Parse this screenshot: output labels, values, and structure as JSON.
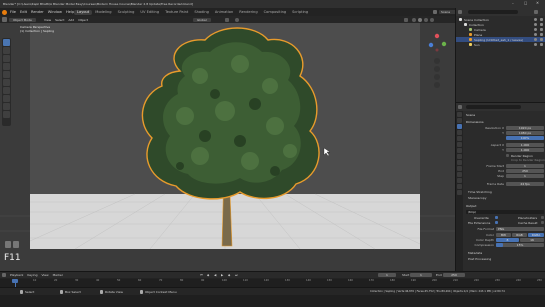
{
  "title_bar": {
    "title": "Blender* [C:\\Users\\Kapil Bhatti\\A Blender Model Easy\\Courses\\Modern House Course\\Blender 2.8 Update\\Free Recorded.blend]"
  },
  "top_menu": [
    "File",
    "Edit",
    "Render",
    "Window",
    "Help"
  ],
  "workspace_tabs": [
    {
      "label": "Layout",
      "active": true
    },
    {
      "label": "Modeling",
      "active": false
    },
    {
      "label": "Sculpting",
      "active": false
    },
    {
      "label": "UV Editing",
      "active": false
    },
    {
      "label": "Texture Paint",
      "active": false
    },
    {
      "label": "Shading",
      "active": false
    },
    {
      "label": "Animation",
      "active": false
    },
    {
      "label": "Rendering",
      "active": false
    },
    {
      "label": "Compositing",
      "active": false
    },
    {
      "label": "Scripting",
      "active": false
    }
  ],
  "scene_name": "Scene",
  "view_layer": "View Layer",
  "viewport": {
    "mode": "Object Mode",
    "menus": [
      "View",
      "Select",
      "Add",
      "Object"
    ],
    "transform_orientation": "Global",
    "info_line1": "Camera Perspective",
    "info_line2": "(1) Collection | Sapling"
  },
  "outliner": {
    "items": [
      {
        "label": "Scene Collection",
        "depth": 0,
        "icon": "collection-icon"
      },
      {
        "label": "Collection",
        "depth": 1,
        "icon": "collection-icon"
      },
      {
        "label": "Camera",
        "depth": 2,
        "icon": "camera-icon"
      },
      {
        "label": "Plane",
        "depth": 2,
        "icon": "mesh-icon"
      },
      {
        "label": "Sapling (Untitled_ash_1 / leaves)",
        "depth": 2,
        "icon": "tree-icon"
      },
      {
        "label": "Sun",
        "depth": 2,
        "icon": "light-icon"
      }
    ]
  },
  "properties": {
    "scene": "Scene",
    "dimensions_header": "Dimensions",
    "resolution_x_label": "Resolution X",
    "resolution_x": "1920 px",
    "resolution_y_label": "Y",
    "resolution_y": "1080 px",
    "percent": "100%",
    "aspect_x_label": "Aspect X",
    "aspect_x": "1.000",
    "aspect_y_label": "Y",
    "aspect_y": "1.000",
    "render_region": "Render Region",
    "crop_region": "Crop to Render Region",
    "frame_start_label": "Frame Start",
    "frame_start": "1",
    "frame_end_label": "End",
    "frame_end": "250",
    "frame_step_label": "Step",
    "frame_step": "1",
    "frame_rate_label": "Frame Rate",
    "frame_rate": "24 fps",
    "time_stretching": "Time Stretching",
    "stereoscopy": "Stereoscopy",
    "output_header": "Output",
    "output_path": "/tmp\\",
    "overwrite": "Overwrite",
    "placeholders": "Placeholders",
    "file_extensions": "File Extensions",
    "cache_result": "Cache Result",
    "file_format_label": "File Format",
    "file_format": "PNG",
    "color_label": "Color",
    "color_bw": "BW",
    "color_rgb": "RGB",
    "color_rgba": "RGBA",
    "color_depth_label": "Color Depth",
    "color_depth_8": "8",
    "color_depth_16": "16",
    "compression_label": "Compression",
    "compression": "15%",
    "metadata": "Metadata",
    "post_processing": "Post Processing"
  },
  "timeline": {
    "menus": [
      "Playback",
      "Keying",
      "View",
      "Marker"
    ],
    "current_frame": "1",
    "start_label": "Start",
    "start": "1",
    "end_label": "End",
    "end": "250",
    "ticks": [
      "0",
      "10",
      "20",
      "30",
      "40",
      "50",
      "60",
      "70",
      "80",
      "90",
      "100",
      "110",
      "120",
      "130",
      "140",
      "150",
      "160",
      "170",
      "180",
      "190",
      "200",
      "210",
      "220",
      "230",
      "240",
      "250"
    ]
  },
  "key_overlay": "F11",
  "status_bar": {
    "select": "Select",
    "box_select": "Box Select",
    "rotate_view": "Rotate View",
    "context_menu": "Object Context Menu",
    "stats": "Collection | Sapling | Verts:46,876 | Faces:45,752 | Tris:89,264 | Objects:1/4 | Mem: 243.1 MB | v2.80.74"
  },
  "colors": {
    "accent": "#4772b3",
    "timeline_playhead": "#4772b3",
    "selection_outline": "#e89b2c"
  }
}
